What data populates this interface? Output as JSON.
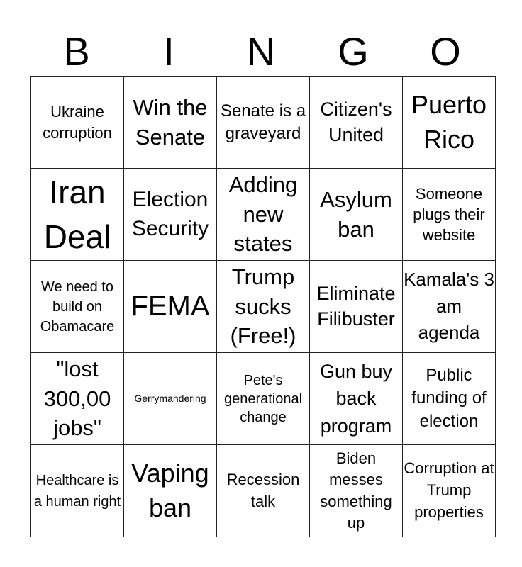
{
  "header": {
    "letters": [
      "B",
      "I",
      "N",
      "G",
      "O"
    ]
  },
  "board": {
    "rows": [
      [
        "Ukraine corruption",
        "Win the Senate",
        "Senate is a graveyard",
        "Citizen's United",
        "Puerto Rico"
      ],
      [
        "Iran Deal",
        "Election Security",
        "Adding new states",
        "Asylum ban",
        "Someone plugs their website"
      ],
      [
        "We need to build on Obamacare",
        "FEMA",
        "Trump sucks (Free!)",
        "Eliminate Filibuster",
        "Kamala's 3 am agenda"
      ],
      [
        "\"lost 300,00 jobs\"",
        "Gerrymandering",
        "Pete's generational change",
        "Gun buy back program",
        "Public funding of election"
      ],
      [
        "Healthcare is a human right",
        "Vaping ban",
        "Recession talk",
        "Biden messes something up",
        "Corruption at Trump properties"
      ]
    ]
  }
}
